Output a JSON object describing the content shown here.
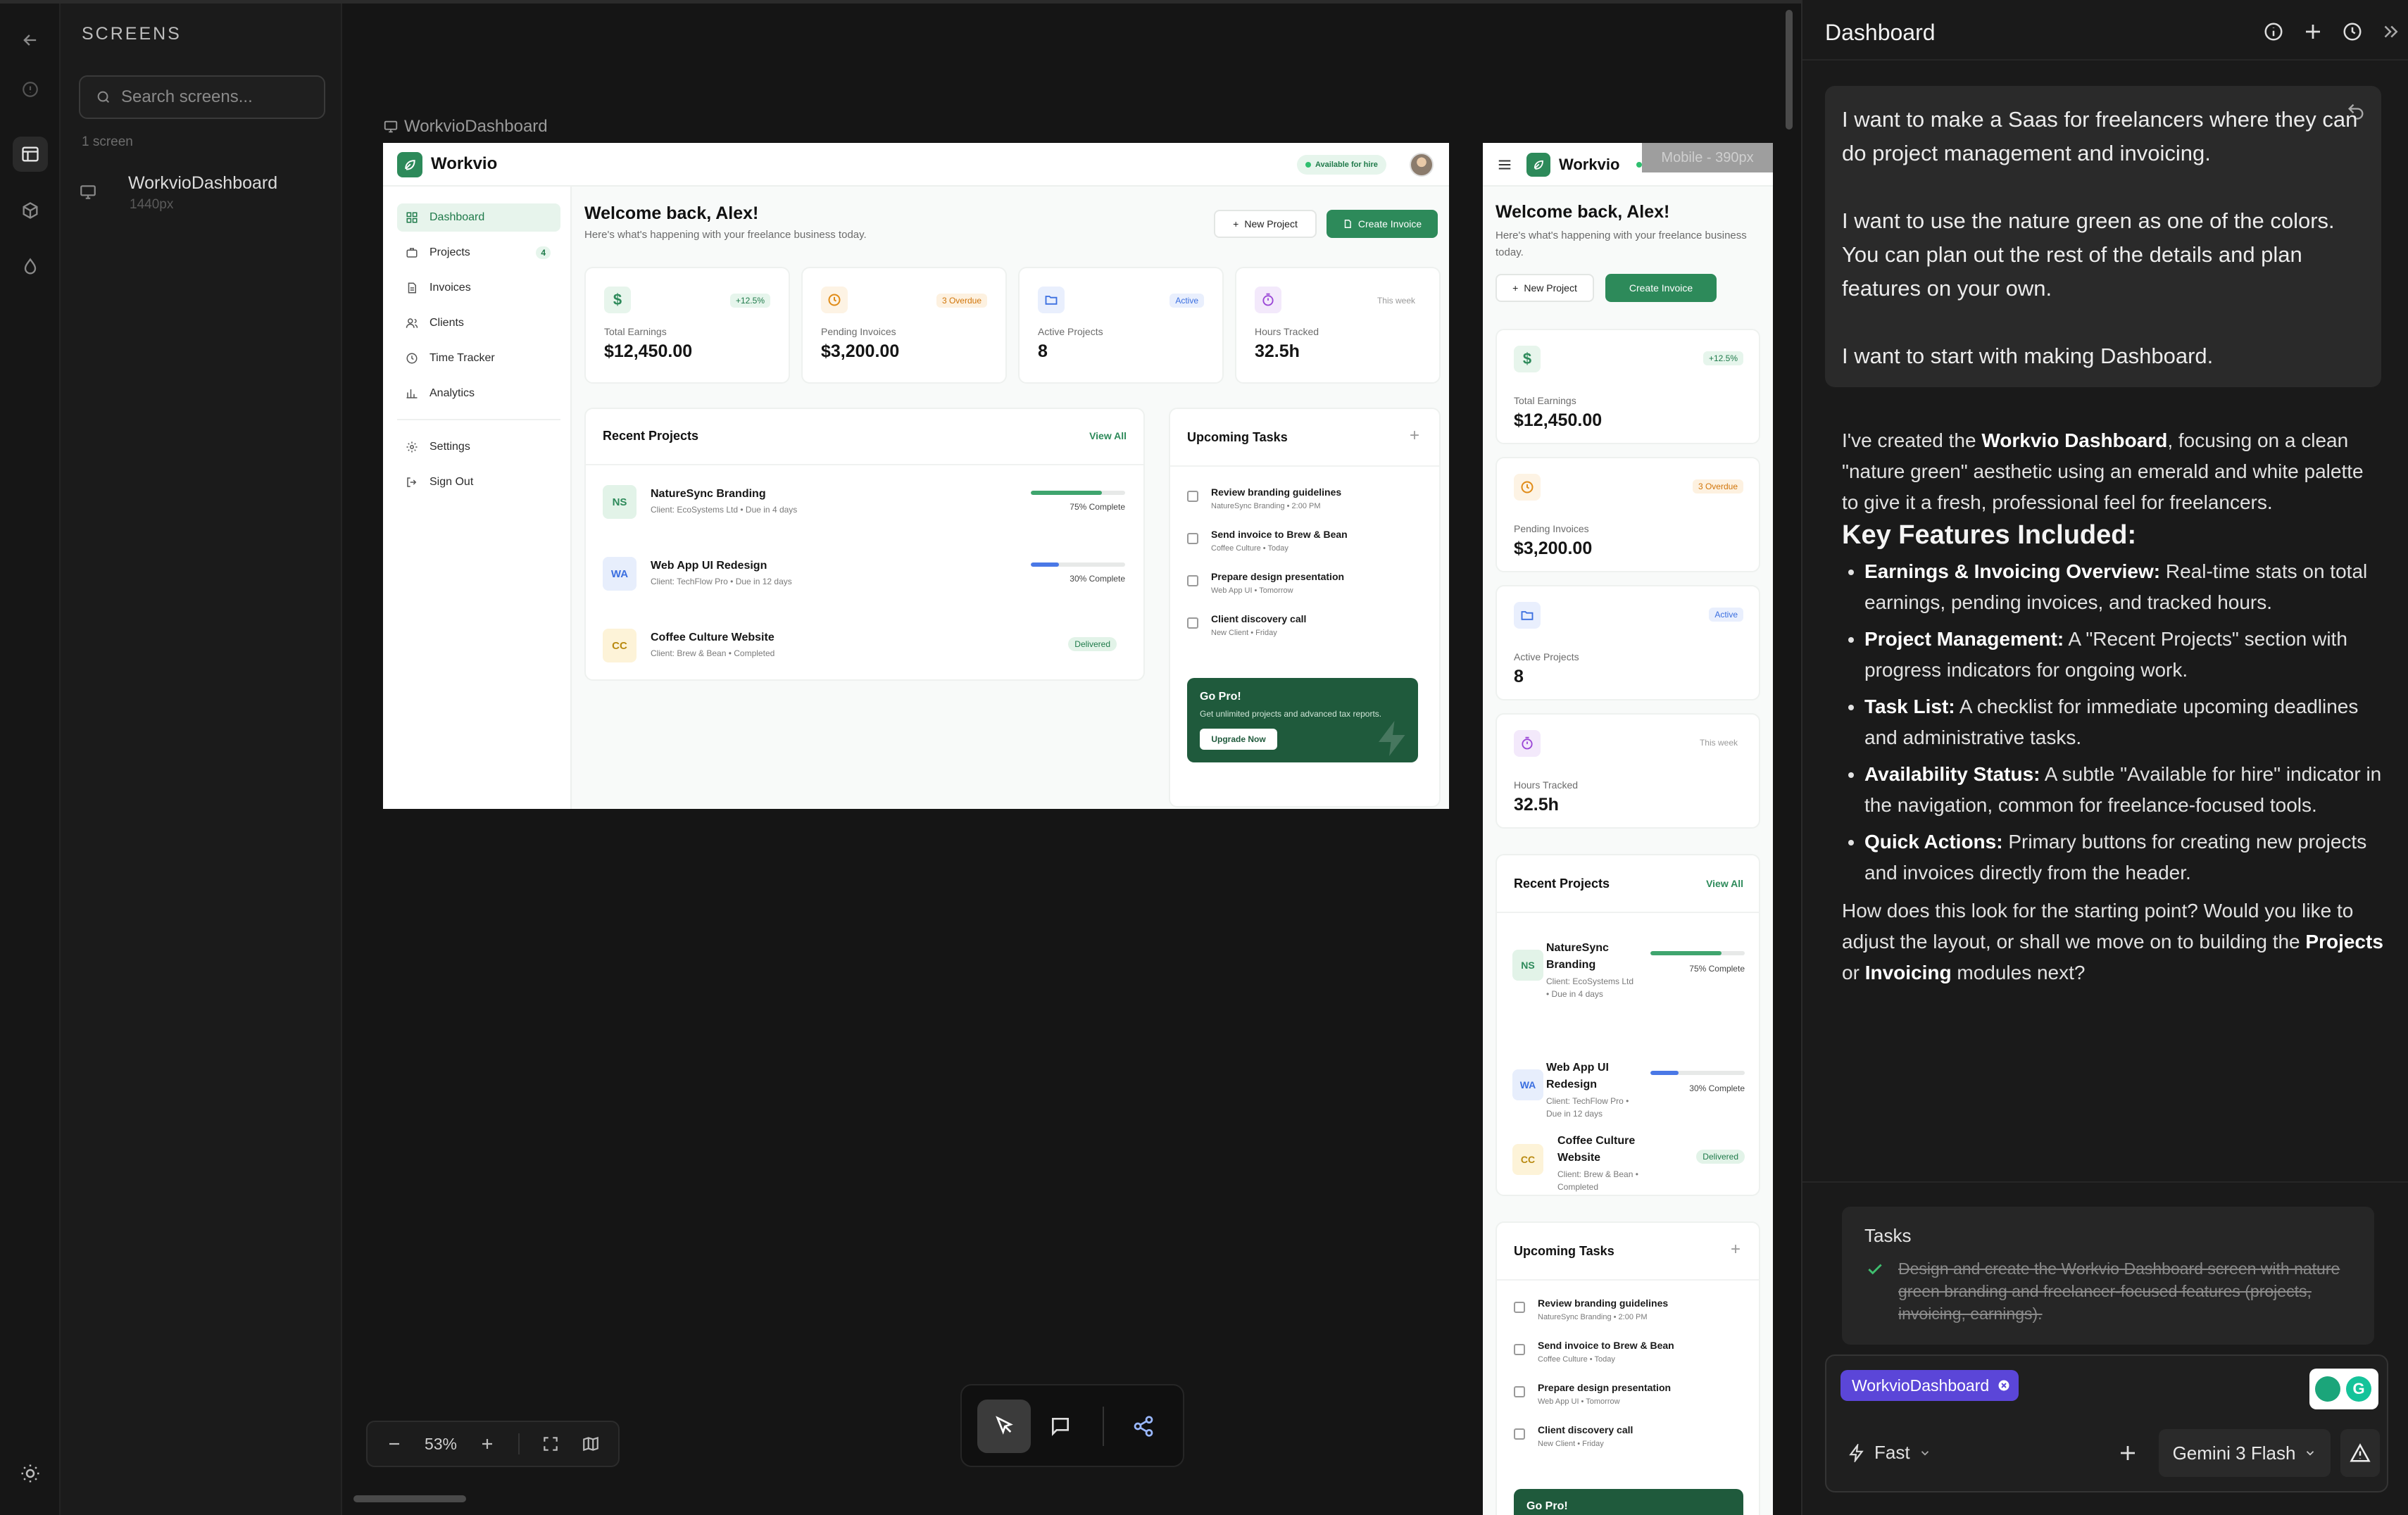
{
  "screens_panel": {
    "title": "SCREENS",
    "search_placeholder": "Search screens...",
    "count": "1 screen",
    "items": [
      {
        "name": "WorkvioDashboard",
        "size": "1440px"
      }
    ]
  },
  "canvas": {
    "frame_label": "WorkvioDashboard",
    "mobile_label": "Mobile - 390px",
    "zoom": "53%"
  },
  "desktop": {
    "brand": "Workvio",
    "availability": "Available for hire",
    "nav": [
      {
        "label": "Dashboard",
        "icon": "grid-icon"
      },
      {
        "label": "Projects",
        "icon": "briefcase-icon",
        "badge": "4"
      },
      {
        "label": "Invoices",
        "icon": "file-icon"
      },
      {
        "label": "Clients",
        "icon": "users-icon"
      },
      {
        "label": "Time Tracker",
        "icon": "clock-icon"
      },
      {
        "label": "Analytics",
        "icon": "chart-icon"
      }
    ],
    "nav_bottom": [
      {
        "label": "Settings",
        "icon": "gear-icon"
      },
      {
        "label": "Sign Out",
        "icon": "logout-icon"
      }
    ],
    "welcome": "Welcome back, Alex!",
    "subtitle": "Here's what's happening with your freelance business today.",
    "new_project": "New Project",
    "create_invoice": "Create Invoice",
    "stats": [
      {
        "label": "Total Earnings",
        "value": "$12,450.00",
        "tag": "+12.5%",
        "icon": "dollar-icon"
      },
      {
        "label": "Pending Invoices",
        "value": "$3,200.00",
        "tag": "3 Overdue",
        "icon": "clock-icon"
      },
      {
        "label": "Active Projects",
        "value": "8",
        "tag": "Active",
        "icon": "folder-icon"
      },
      {
        "label": "Hours Tracked",
        "value": "32.5h",
        "tag": "This week",
        "icon": "stopwatch-icon"
      }
    ],
    "recent_projects": {
      "title": "Recent Projects",
      "view_all": "View All",
      "items": [
        {
          "initials": "NS",
          "name": "NatureSync Branding",
          "client": "Client: EcoSystems Ltd • Due in 4 days",
          "status": "75% Complete",
          "progress": 0.75
        },
        {
          "initials": "WA",
          "name": "Web App UI Redesign",
          "client": "Client: TechFlow Pro • Due in 12 days",
          "status": "30% Complete",
          "progress": 0.3
        },
        {
          "initials": "CC",
          "name": "Coffee Culture Website",
          "client": "Client: Brew & Bean • Completed",
          "status": "Delivered"
        }
      ]
    },
    "tasks": {
      "title": "Upcoming Tasks",
      "items": [
        {
          "name": "Review branding guidelines",
          "sub": "NatureSync Branding • 2:00 PM"
        },
        {
          "name": "Send invoice to Brew & Bean",
          "sub": "Coffee Culture • Today"
        },
        {
          "name": "Prepare design presentation",
          "sub": "Web App UI • Tomorrow"
        },
        {
          "name": "Client discovery call",
          "sub": "New Client • Friday"
        }
      ]
    },
    "gopro": {
      "title": "Go Pro!",
      "text": "Get unlimited projects and advanced tax reports.",
      "button": "Upgrade Now"
    }
  },
  "mobile": {
    "brand": "Workvio",
    "welcome": "Welcome back, Alex!",
    "subtitle": "Here's what's happening with your freelance business today.",
    "new_project": "New Project",
    "create_invoice": "Create Invoice",
    "project_names_wrapped": [
      [
        "NatureSync",
        "Branding"
      ],
      [
        "Web App UI",
        "Redesign"
      ],
      [
        "Coffee Culture",
        "Website"
      ]
    ],
    "project_clients_wrapped": [
      [
        "Client: EcoSystems Ltd",
        "• Due in 4 days"
      ],
      [
        "Client: TechFlow Pro •",
        "Due in 12 days"
      ],
      [
        "Client: Brew & Bean •",
        "Completed"
      ]
    ]
  },
  "chat": {
    "title": "Dashboard",
    "user_message": [
      "I want to make a Saas for freelancers where they can do project management and invoicing.",
      "I want to use the nature green as one of the colors. You can plan out the rest of the details and plan features on your own.",
      "I want to start with making Dashboard."
    ],
    "ai_intro_pre": "I've created the ",
    "ai_intro_bold": "Workvio Dashboard",
    "ai_intro_post": ", focusing on a clean \"nature green\" aesthetic using an emerald and white palette to give it a fresh, professional feel for freelancers.",
    "features_heading": "Key Features Included:",
    "features": [
      {
        "title": "Earnings & Invoicing Overview:",
        "text": " Real-time stats on total earnings, pending invoices, and tracked hours."
      },
      {
        "title": "Project Management:",
        "text": " A \"Recent Projects\" section with progress indicators for ongoing work."
      },
      {
        "title": "Task List:",
        "text": " A checklist for immediate upcoming deadlines and administrative tasks."
      },
      {
        "title": "Availability Status:",
        "text": " A subtle \"Available for hire\" indicator in the navigation, common for freelance-focused tools."
      },
      {
        "title": "Quick Actions:",
        "text": " Primary buttons for creating new projects and invoices directly from the header."
      }
    ],
    "closing_pre": "How does this look for the starting point? Would you like to adjust the layout, or shall we move on to building the ",
    "closing_b1": "Projects",
    "closing_mid": " or ",
    "closing_b2": "Invoicing",
    "closing_post": " modules next?",
    "tasks_title": "Tasks",
    "task_done": "Design and create the Workvio Dashboard screen with nature green branding and freelancer-focused features (projects, invoicing, earnings).",
    "chip": "WorkvioDashboard",
    "mode": "Fast",
    "model": "Gemini 3 Flash"
  },
  "colors": {
    "brand_green": "#2d8a5a",
    "chip_purple": "#5b46d8"
  }
}
